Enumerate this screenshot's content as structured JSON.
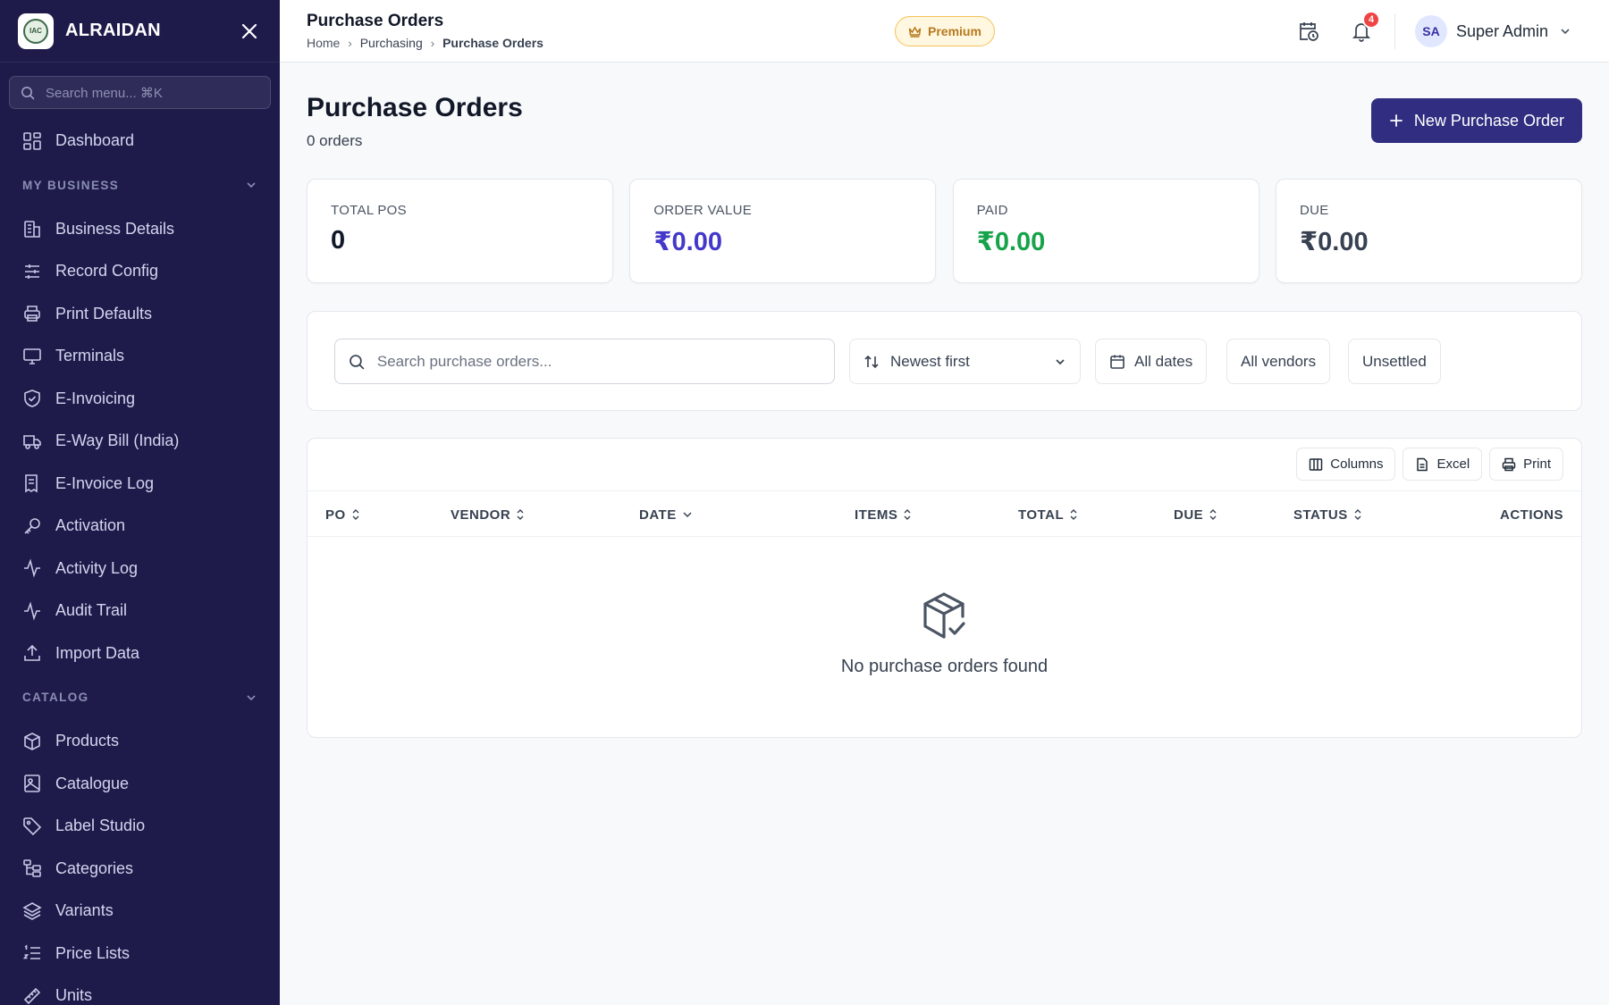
{
  "sidebar": {
    "brand": "ALRAIDAN",
    "logo_text": "IAC",
    "search_placeholder": "Search menu... ⌘K",
    "dashboard": "Dashboard",
    "sections": [
      {
        "title": "MY BUSINESS",
        "items": [
          "Business Details",
          "Record Config",
          "Print Defaults",
          "Terminals",
          "E-Invoicing",
          "E-Way Bill (India)",
          "E-Invoice Log",
          "Activation",
          "Activity Log",
          "Audit Trail",
          "Import Data"
        ]
      },
      {
        "title": "CATALOG",
        "items": [
          "Products",
          "Catalogue",
          "Label Studio",
          "Categories",
          "Variants",
          "Price Lists",
          "Units"
        ]
      }
    ]
  },
  "header": {
    "title": "Purchase Orders",
    "breadcrumb": [
      "Home",
      "Purchasing",
      "Purchase Orders"
    ],
    "premium": "Premium",
    "notifications_count": "4",
    "user_initials": "SA",
    "user_name": "Super Admin"
  },
  "page": {
    "title": "Purchase Orders",
    "subtitle": "0 orders",
    "new_button": "New Purchase Order"
  },
  "stats": [
    {
      "label": "TOTAL POS",
      "value": "0",
      "color": "#111827"
    },
    {
      "label": "ORDER VALUE",
      "value": "₹0.00",
      "color": "#4338ca"
    },
    {
      "label": "PAID",
      "value": "₹0.00",
      "color": "#16a34a"
    },
    {
      "label": "DUE",
      "value": "₹0.00",
      "color": "#374151"
    }
  ],
  "filters": {
    "search_placeholder": "Search purchase orders...",
    "sort": "Newest first",
    "dates": "All dates",
    "vendors": "All vendors",
    "status": "Unsettled"
  },
  "table": {
    "tools": [
      "Columns",
      "Excel",
      "Print"
    ],
    "columns": [
      "PO",
      "VENDOR",
      "DATE",
      "ITEMS",
      "TOTAL",
      "DUE",
      "STATUS",
      "ACTIONS"
    ],
    "empty_text": "No purchase orders found"
  },
  "colors": {
    "sidebar_bg": "#1e1b4b",
    "primary_button": "#312e81",
    "premium_text": "#b7791f"
  }
}
